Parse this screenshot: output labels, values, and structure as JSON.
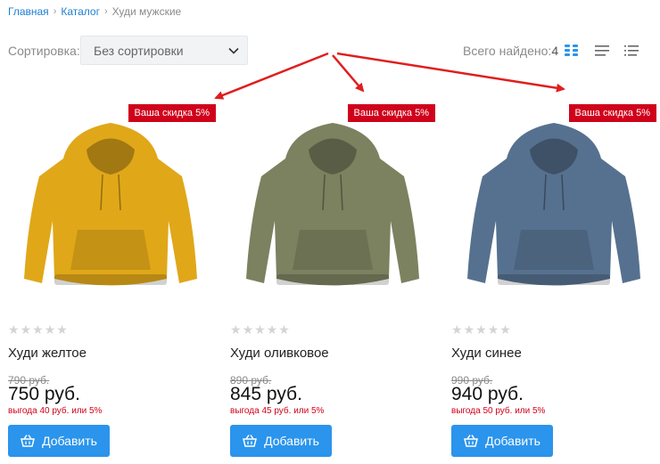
{
  "breadcrumb": {
    "items": [
      "Главная",
      "Каталог"
    ],
    "current": "Худи мужские"
  },
  "sort": {
    "label": "Сортировка:",
    "value": "Без сортировки"
  },
  "total": {
    "label": "Всего найдено:",
    "count": "4"
  },
  "view_icons": [
    "grid-view-icon",
    "list-view-icon",
    "compact-list-view-icon"
  ],
  "colors": {
    "accent": "#2b94ec",
    "badge": "#d0021b",
    "link": "#1f7fcf",
    "arrow": "#e01e1e"
  },
  "products": [
    {
      "badge": "Ваша скидка 5%",
      "title": "Худи желтое",
      "old_price": "790 руб.",
      "price": "750 руб.",
      "saving": "выгода 40 руб. или 5%",
      "button": "Добавить",
      "hoodie_color": "#e0a719",
      "rating": 0
    },
    {
      "badge": "Ваша скидка 5%",
      "title": "Худи оливковое",
      "old_price": "890 руб.",
      "price": "845 руб.",
      "saving": "выгода 45 руб. или 5%",
      "button": "Добавить",
      "hoodie_color": "#7c8160",
      "rating": 0
    },
    {
      "badge": "Ваша скидка 5%",
      "title": "Худи синее",
      "old_price": "990 руб.",
      "price": "940 руб.",
      "saving": "выгода 50 руб. или 5%",
      "button": "Добавить",
      "hoodie_color": "#56718f",
      "rating": 0
    }
  ]
}
